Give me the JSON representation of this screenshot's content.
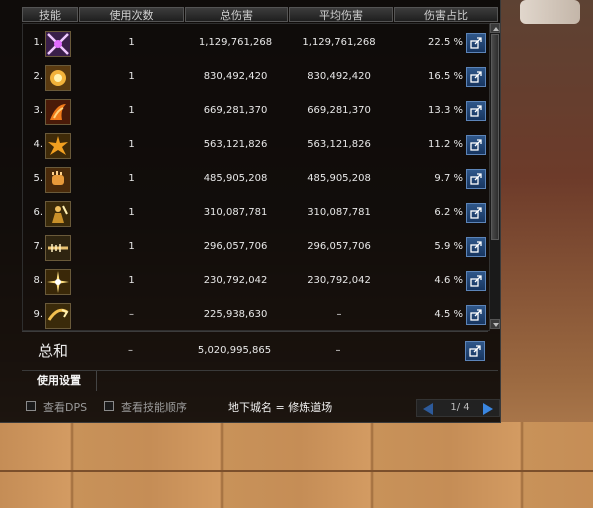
{
  "header": {
    "col_skill": "技能",
    "col_uses": "使用次数",
    "col_total": "总伤害",
    "col_avg": "平均伤害",
    "col_pct": "伤害占比"
  },
  "rows": [
    {
      "rank": "1.",
      "uses": "1",
      "total": "1,129,761,268",
      "avg": "1,129,761,268",
      "pct": "22.5 %",
      "icon": "cross-slash-skill-icon"
    },
    {
      "rank": "2.",
      "uses": "1",
      "total": "830,492,420",
      "avg": "830,492,420",
      "pct": "16.5 %",
      "icon": "burst-skill-icon"
    },
    {
      "rank": "3.",
      "uses": "1",
      "total": "669,281,370",
      "avg": "669,281,370",
      "pct": "13.3 %",
      "icon": "flame-strike-skill-icon"
    },
    {
      "rank": "4.",
      "uses": "1",
      "total": "563,121,826",
      "avg": "563,121,826",
      "pct": "11.2 %",
      "icon": "explosion-skill-icon"
    },
    {
      "rank": "5.",
      "uses": "1",
      "total": "485,905,208",
      "avg": "485,905,208",
      "pct": "9.7 %",
      "icon": "fist-skill-icon"
    },
    {
      "rank": "6.",
      "uses": "1",
      "total": "310,087,781",
      "avg": "310,087,781",
      "pct": "6.2 %",
      "icon": "warrior-skill-icon"
    },
    {
      "rank": "7.",
      "uses": "1",
      "total": "296,057,706",
      "avg": "296,057,706",
      "pct": "5.9 %",
      "icon": "blade-skill-icon"
    },
    {
      "rank": "8.",
      "uses": "1",
      "total": "230,792,042",
      "avg": "230,792,042",
      "pct": "4.6 %",
      "icon": "star-burst-skill-icon"
    },
    {
      "rank": "9.",
      "uses": "–",
      "total": "225,938,630",
      "avg": "–",
      "pct": "4.5 %",
      "icon": "dash-skill-icon"
    }
  ],
  "total": {
    "label": "总和",
    "uses": "–",
    "total": "5,020,995,865",
    "avg": "–"
  },
  "tabs": {
    "settings": "使用设置"
  },
  "bottom": {
    "view_dps": "查看DPS",
    "view_order": "查看技能顺序",
    "dungeon": "地下城名 = 修炼道场",
    "page": "1/ 4"
  },
  "icons": {
    "share": "share-icon",
    "prev": "prev-page-icon",
    "next": "next-page-icon"
  },
  "colors": {
    "accent_blue": "#3a86e0",
    "panel_bg": "#080808",
    "text": "#e8e8e8"
  }
}
